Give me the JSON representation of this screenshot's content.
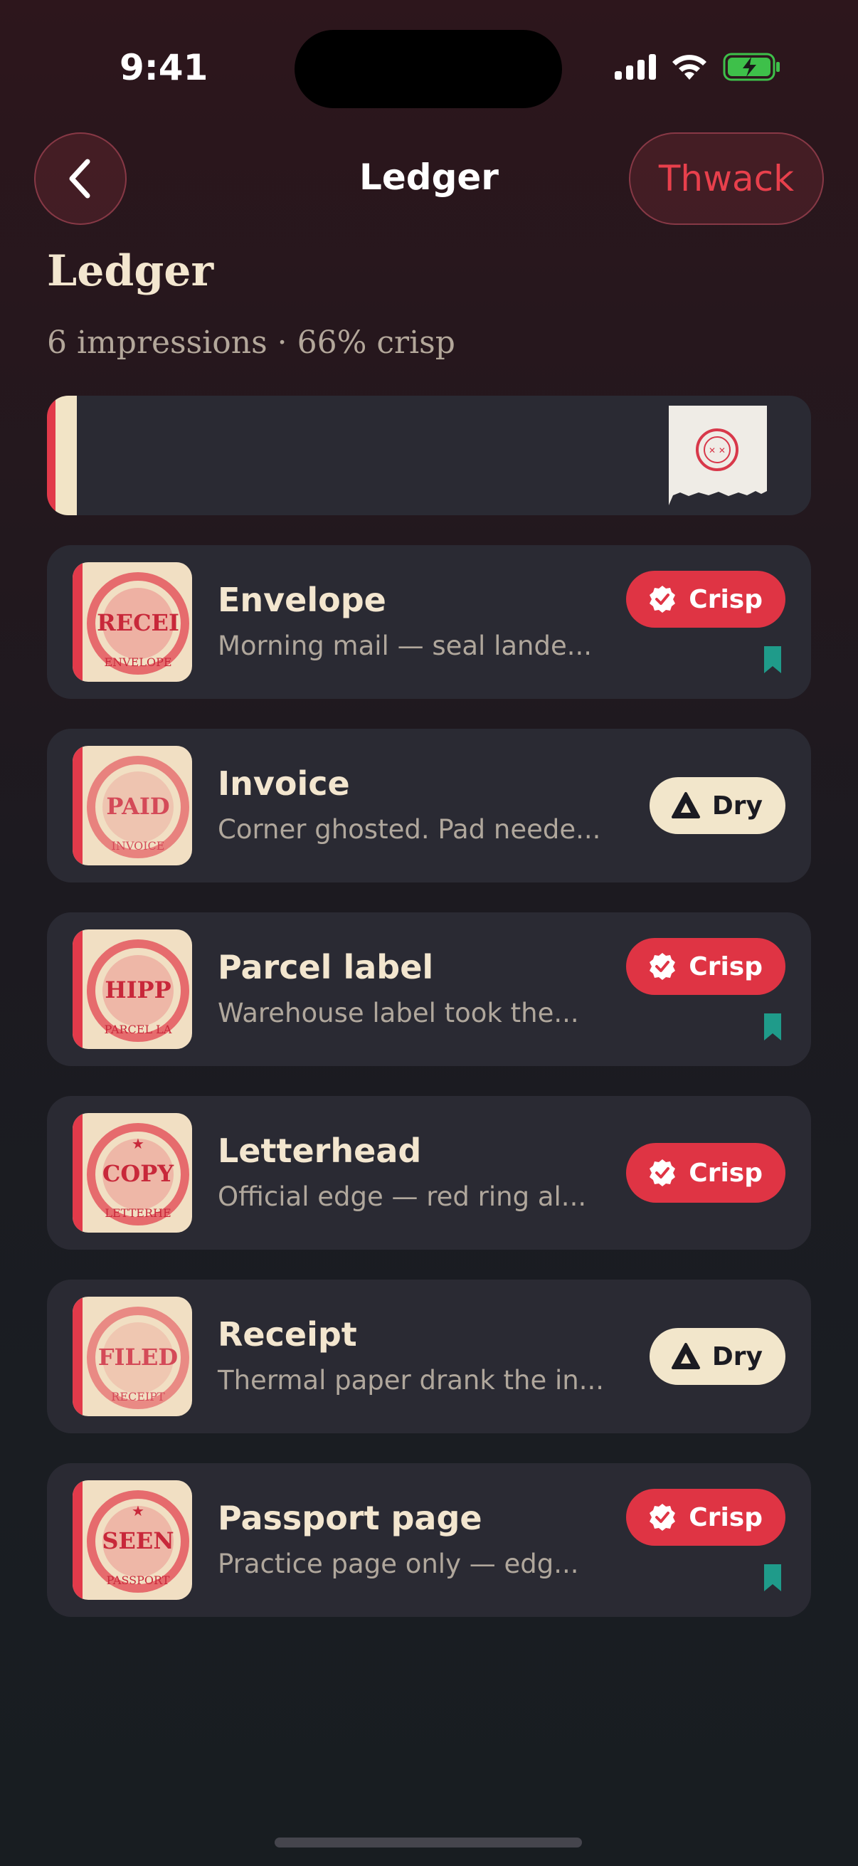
{
  "status_bar": {
    "time": "9:41"
  },
  "nav": {
    "title": "Ledger",
    "action_label": "Thwack"
  },
  "header": {
    "title": "Ledger",
    "subtitle": "6 impressions · 66% crisp"
  },
  "colors": {
    "accent": "#df3444",
    "cream": "#f2e6cb",
    "card": "#2a2a33",
    "bookmark": "#1f9b8a"
  },
  "entries": [
    {
      "title": "Envelope",
      "desc": "Morning mail — seal lande...",
      "status": "Crisp",
      "bookmarked": true
    },
    {
      "title": "Invoice",
      "desc": "Corner ghosted. Pad neede...",
      "status": "Dry",
      "bookmarked": false
    },
    {
      "title": "Parcel label",
      "desc": "Warehouse label took the...",
      "status": "Crisp",
      "bookmarked": true
    },
    {
      "title": "Letterhead",
      "desc": "Official edge — red ring al...",
      "status": "Crisp",
      "bookmarked": false
    },
    {
      "title": "Receipt",
      "desc": "Thermal paper drank the in...",
      "status": "Dry",
      "bookmarked": false
    },
    {
      "title": "Passport page",
      "desc": "Practice page only — edg...",
      "status": "Crisp",
      "bookmarked": true
    }
  ]
}
